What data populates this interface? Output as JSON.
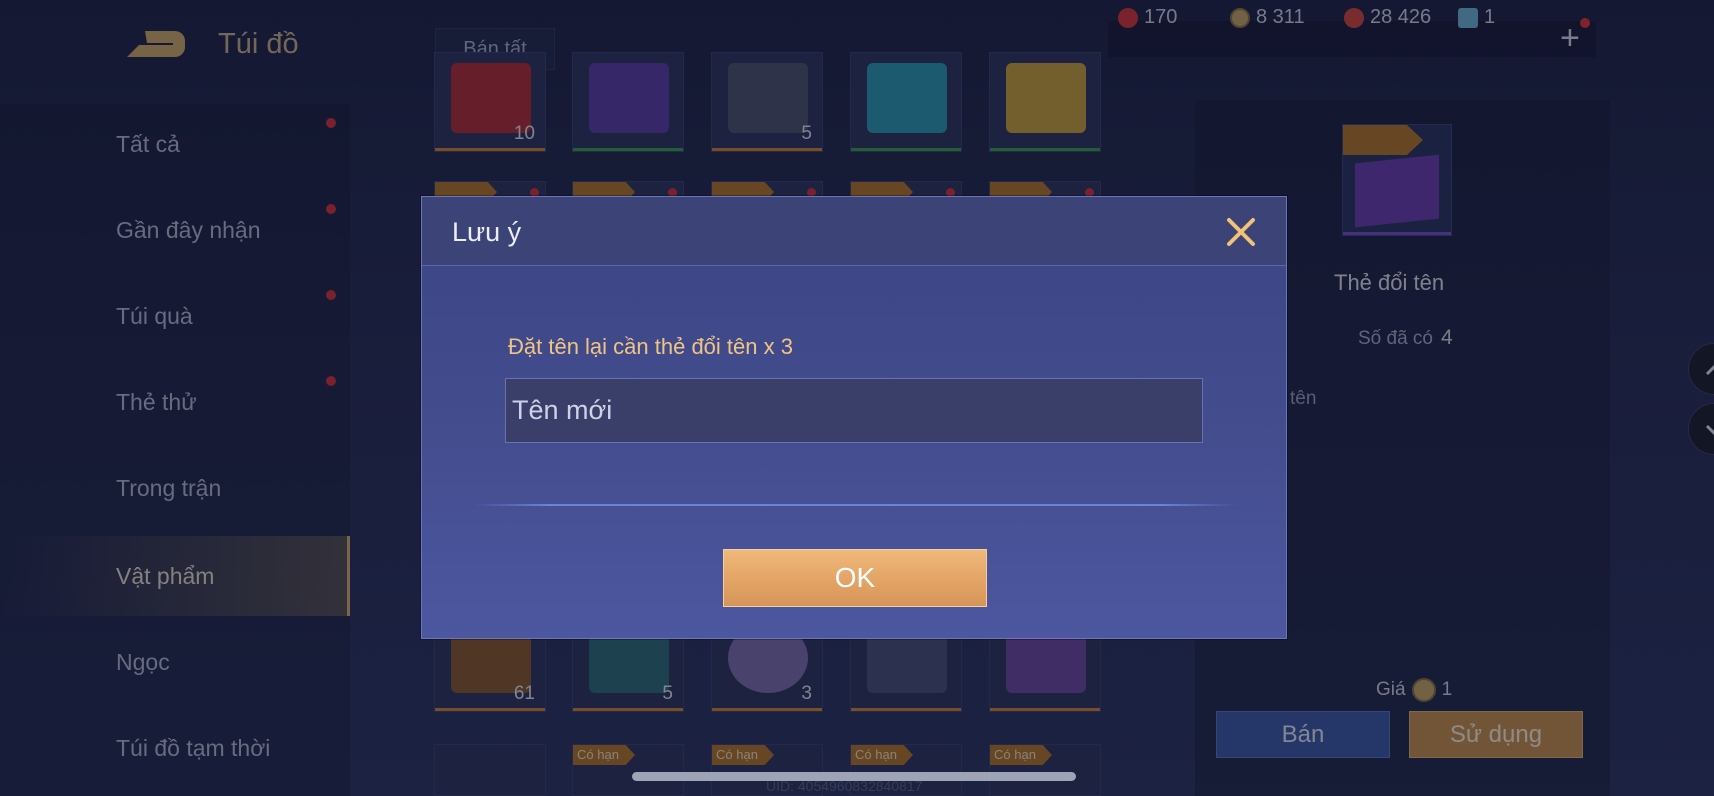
{
  "header": {
    "title": "Túi đồ",
    "sell_all": "Bán tất",
    "currencies": [
      {
        "icon": "red-gem-icon",
        "value": "170",
        "color": "#d8373f"
      },
      {
        "icon": "gold-coin-icon",
        "value": "8 311",
        "color": "#c9a867"
      },
      {
        "icon": "red-voucher-icon",
        "value": "28 426",
        "color": "#d6483f"
      },
      {
        "icon": "ticket-icon",
        "value": "1",
        "color": "#6fb6d8"
      }
    ],
    "plus": "+"
  },
  "sidebar": {
    "items": [
      {
        "label": "Tất cả",
        "dot": true
      },
      {
        "label": "Gần đây nhận",
        "dot": true
      },
      {
        "label": "Túi quà",
        "dot": true
      },
      {
        "label": "Thẻ thử",
        "dot": true
      },
      {
        "label": "Trong trận",
        "dot": false
      },
      {
        "label": "Vật phẩm",
        "dot": false,
        "active": true
      },
      {
        "label": "Ngọc",
        "dot": false
      },
      {
        "label": "Túi đồ tạm thời",
        "dot": false
      }
    ]
  },
  "grid": {
    "row1_counts": [
      "10",
      "",
      "5",
      "",
      ""
    ],
    "row_bottom_counts": [
      "61",
      "5",
      "3",
      "",
      ""
    ],
    "partial_tag": "Có hạn"
  },
  "detail": {
    "name": "Thẻ đổi tên",
    "owned_label": "Số đã có",
    "owned_value": "4",
    "desc_fragment": "tên",
    "price_label": "Giá",
    "price_value": "1",
    "sell": "Bán",
    "use": "Sử dụng"
  },
  "footer": {
    "uid": "UID: 4054960832840817"
  },
  "modal": {
    "title": "Lưu ý",
    "hint": "Đặt tên lại cần thẻ đổi tên x 3",
    "input_placeholder": "Tên mới",
    "input_value": "",
    "ok": "OK"
  }
}
